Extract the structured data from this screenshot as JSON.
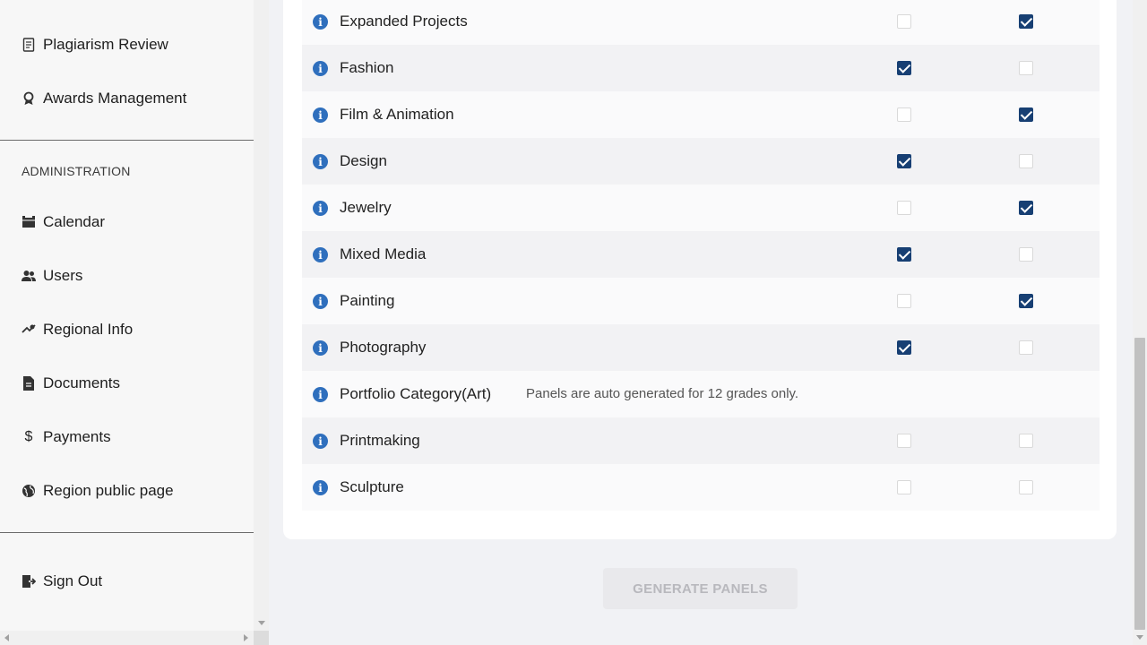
{
  "sidebar": {
    "top_items": [
      {
        "label": "Plagiarism Review",
        "icon": "document-search-icon"
      },
      {
        "label": "Awards Management",
        "icon": "award-icon"
      }
    ],
    "admin_heading": "ADMINISTRATION",
    "admin_items": [
      {
        "label": "Calendar",
        "icon": "calendar-icon"
      },
      {
        "label": "Users",
        "icon": "users-icon"
      },
      {
        "label": "Regional Info",
        "icon": "map-pin-icon"
      },
      {
        "label": "Documents",
        "icon": "file-icon"
      },
      {
        "label": "Payments",
        "icon": "dollar-icon"
      },
      {
        "label": "Region public page",
        "icon": "globe-icon"
      }
    ],
    "sign_out": {
      "label": "Sign Out",
      "icon": "sign-out-icon"
    }
  },
  "categories": [
    {
      "label": "Expanded Projects",
      "col1": false,
      "col2": true
    },
    {
      "label": "Fashion",
      "col1": true,
      "col2": false
    },
    {
      "label": "Film & Animation",
      "col1": false,
      "col2": true
    },
    {
      "label": "Design",
      "col1": true,
      "col2": false
    },
    {
      "label": "Jewelry",
      "col1": false,
      "col2": true
    },
    {
      "label": "Mixed Media",
      "col1": true,
      "col2": false
    },
    {
      "label": "Painting",
      "col1": false,
      "col2": true
    },
    {
      "label": "Photography",
      "col1": true,
      "col2": false
    },
    {
      "label": "Portfolio Category(Art)",
      "note": "Panels are auto generated for 12 grades only."
    },
    {
      "label": "Printmaking",
      "col1": false,
      "col2": false
    },
    {
      "label": "Sculpture",
      "col1": false,
      "col2": false
    }
  ],
  "generate_button": {
    "label": "GENERATE PANELS",
    "enabled": false
  },
  "colors": {
    "checkbox_checked": "#173f73",
    "info_icon": "#2f6fbd",
    "button_disabled_bg": "#e9e9ec"
  }
}
